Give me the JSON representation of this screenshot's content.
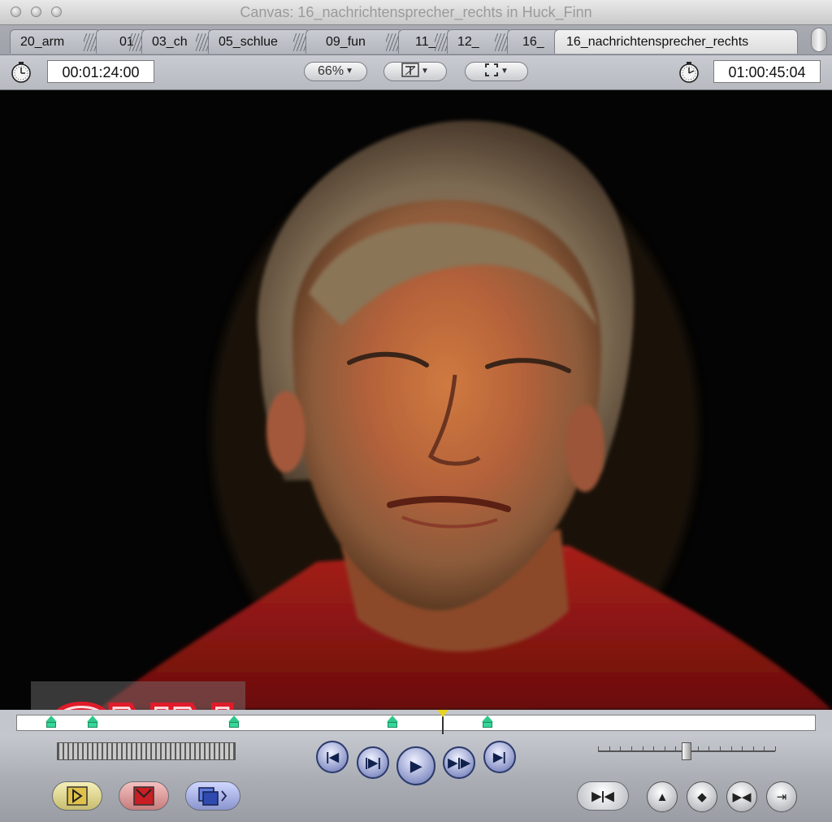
{
  "window": {
    "title": "Canvas: 16_nachrichtensprecher_rechts in Huck_Finn"
  },
  "tabs": [
    {
      "label": "20_arm"
    },
    {
      "label": "01"
    },
    {
      "label": "03_ch"
    },
    {
      "label": "05_schlue"
    },
    {
      "label": "09_fun"
    },
    {
      "label": "11_"
    },
    {
      "label": "12_"
    },
    {
      "label": "16_"
    },
    {
      "label": "16_nachrichtensprecher_rechts",
      "active": true
    }
  ],
  "toolbar": {
    "duration_timecode": "00:01:24:00",
    "zoom_label": "66%",
    "view_icon": "title-safe-icon",
    "overlay_icon": "frame-fit-icon",
    "current_timecode": "01:00:45:04"
  },
  "canvas": {
    "logo_text": "CNN"
  },
  "scrubber": {
    "marker_positions_percent": [
      4.3,
      9.5,
      27.1,
      47.0,
      58.8
    ],
    "playhead_percent": 53.2
  },
  "transport": {
    "buttons": [
      "go-to-previous-edit-icon",
      "play-in-to-out-icon",
      "play-icon",
      "play-around-current-icon",
      "go-to-next-edit-icon"
    ],
    "shuttle_position_percent": 50
  },
  "edit_buttons": [
    "insert-edit-icon",
    "overwrite-edit-icon",
    "replace-edit-icon"
  ],
  "right_buttons": [
    "mark-in-out-icon",
    "add-keyframe-icon",
    "add-marker-icon",
    "mark-clip-icon",
    "match-frame-icon"
  ]
}
